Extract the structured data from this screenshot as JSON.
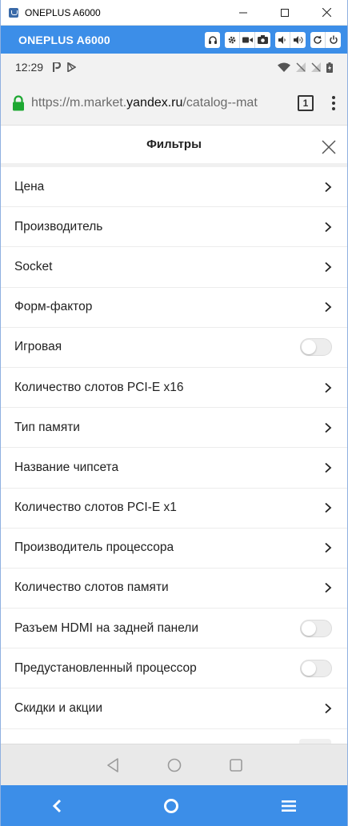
{
  "window": {
    "title": "ONEPLUS A6000"
  },
  "emulator": {
    "device_name": "ONEPLUS A6000",
    "toolbar_icons": [
      "headphones-icon",
      "gear-icon",
      "video-camera-icon",
      "camera-icon",
      "volume-down-icon",
      "volume-up-icon",
      "rotate-icon",
      "power-icon"
    ]
  },
  "status_bar": {
    "time": "12:29"
  },
  "browser": {
    "url_prefix": "https://m.market.",
    "url_domain": "yandex.ru",
    "url_rest": "/catalog--mat",
    "tab_count": "1"
  },
  "filters": {
    "title": "Фильтры",
    "items": [
      {
        "label": "Цена",
        "control": "chevron"
      },
      {
        "label": "Производитель",
        "control": "chevron"
      },
      {
        "label": "Socket",
        "control": "chevron"
      },
      {
        "label": "Форм-фактор",
        "control": "chevron"
      },
      {
        "label": "Игровая",
        "control": "toggle"
      },
      {
        "label": "Количество слотов PCI-E x16",
        "control": "chevron"
      },
      {
        "label": "Тип памяти",
        "control": "chevron"
      },
      {
        "label": "Название чипсета",
        "control": "chevron"
      },
      {
        "label": "Количество слотов PCI-E x1",
        "control": "chevron"
      },
      {
        "label": "Производитель процессора",
        "control": "chevron"
      },
      {
        "label": "Количество слотов памяти",
        "control": "chevron"
      },
      {
        "label": "Разъем HDMI на задней панели",
        "control": "toggle"
      },
      {
        "label": "Предустановленный процессор",
        "control": "toggle"
      },
      {
        "label": "Скидки и акции",
        "control": "chevron"
      }
    ]
  },
  "colors": {
    "emulator_blue": "#3c8ee8",
    "lock_green": "#1ea832"
  }
}
